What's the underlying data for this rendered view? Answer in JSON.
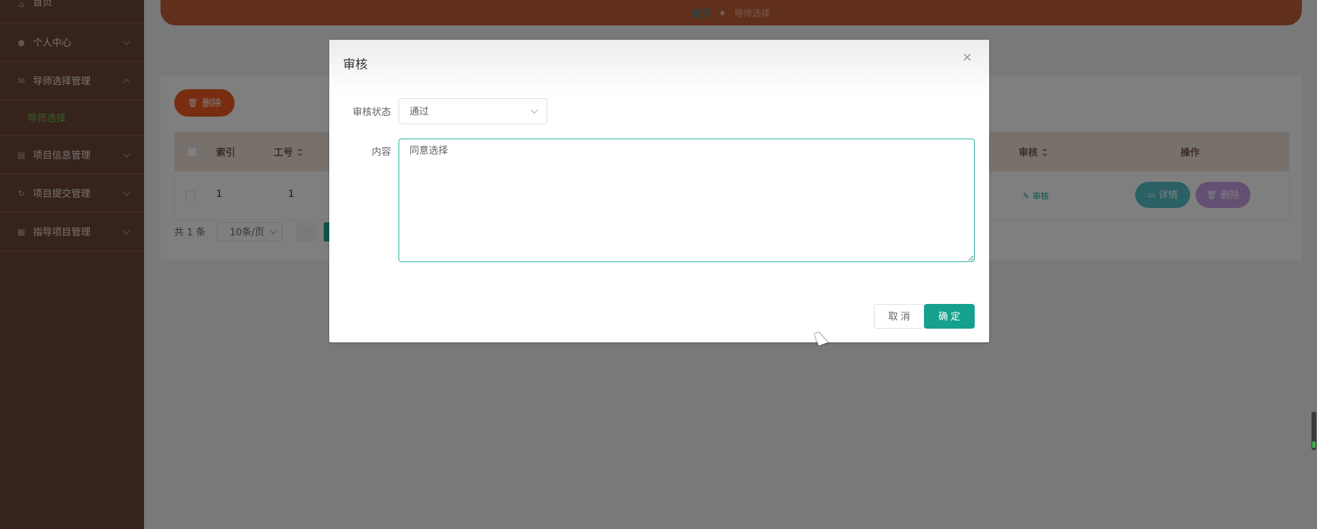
{
  "sidebar": {
    "items": [
      {
        "label": "首页"
      },
      {
        "label": "个人中心"
      },
      {
        "label": "导师选择管理"
      },
      {
        "label": "导师选择"
      },
      {
        "label": "项目信息管理"
      },
      {
        "label": "项目提交管理"
      },
      {
        "label": "指导项目管理"
      }
    ]
  },
  "breadcrumb": {
    "home": "首页",
    "current": "导师选择"
  },
  "toolbar": {
    "delete_label": "删除"
  },
  "table": {
    "headers": {
      "index": "索引",
      "id": "工号",
      "review": "审核",
      "actions": "操作"
    },
    "rows": [
      {
        "index": "1",
        "id": "1",
        "review": "审核",
        "detail": "详情",
        "delete": "删除"
      }
    ]
  },
  "pagination": {
    "total": "共 1 条",
    "page_size": "10条/页"
  },
  "dialog": {
    "title": "审核",
    "status_label": "审核状态",
    "status_value": "通过",
    "content_label": "内容",
    "content_value": "同意选择",
    "cancel_label": "取 消",
    "confirm_label": "确 定"
  },
  "colors": {
    "sidebar": "#6d4636",
    "accent": "#16a08e",
    "danger": "#f05a22",
    "detail_btn": "#56c3c9",
    "delete_btn": "#c8a0e6"
  }
}
